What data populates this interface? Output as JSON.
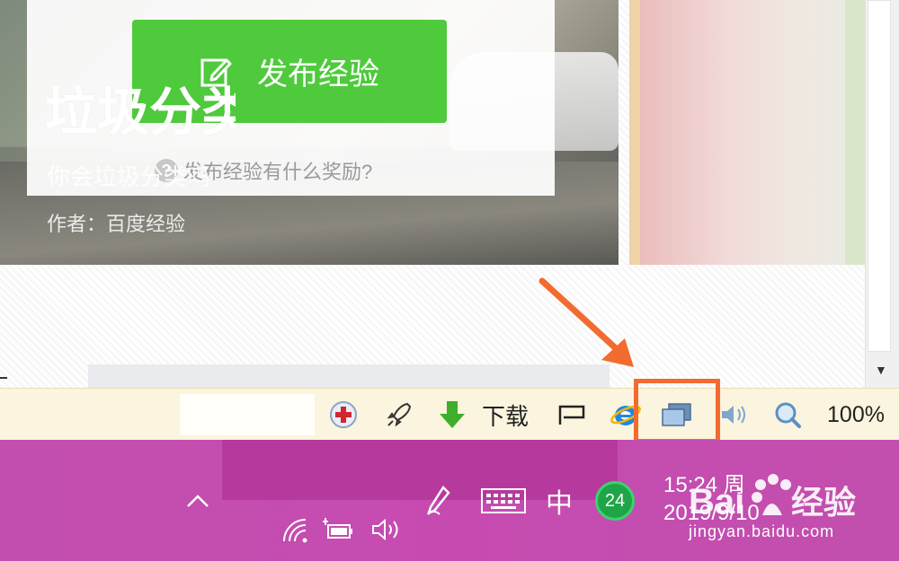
{
  "web": {
    "publish_button_label": "发布经验",
    "reward_link_text": "发布经验有什么奖励?",
    "article": {
      "title": "垃圾分类",
      "subtitle": "你会垃圾分类吗",
      "author": "作者：百度经验"
    }
  },
  "status_bar": {
    "download_label": "下载",
    "zoom_level": "100%"
  },
  "taskbar": {
    "ime_label": "中",
    "notification_count": "24",
    "time": "15:24 周",
    "date": "2019/9/10"
  },
  "watermark": {
    "brand": "Bai 经验",
    "url": "jingyan.baidu.com"
  },
  "colors": {
    "publish_green": "#4fca3d",
    "highlight_orange": "#f26b2f",
    "taskbar_magenta": "#c64bb1",
    "status_bar_bg": "#fbf4de"
  }
}
